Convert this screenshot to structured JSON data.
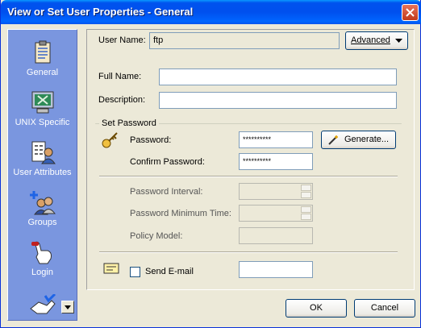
{
  "window": {
    "title": "View or Set User Properties - General"
  },
  "sidebar": {
    "items": [
      {
        "label": "General",
        "icon": "clipboard-icon"
      },
      {
        "label": "UNIX Specific",
        "icon": "unix-terminal-icon"
      },
      {
        "label": "User Attributes",
        "icon": "user-attributes-icon"
      },
      {
        "label": "Groups",
        "icon": "groups-icon"
      },
      {
        "label": "Login",
        "icon": "login-hand-icon"
      }
    ],
    "more_icon": "handshake-icon"
  },
  "header": {
    "user_name_label": "User Name:",
    "user_name_value": "ftp",
    "advanced_label": "Advanced"
  },
  "form": {
    "full_name_label": "Full Name:",
    "full_name_value": "",
    "description_label": "Description:",
    "description_value": ""
  },
  "set_password": {
    "group_title": "Set Password",
    "password_label": "Password:",
    "password_value": "**********",
    "confirm_label": "Confirm Password:",
    "confirm_value": "**********",
    "generate_label": "Generate...",
    "interval_label": "Password Interval:",
    "min_time_label": "Password Minimum Time:",
    "policy_label": "Policy Model:"
  },
  "email": {
    "send_label": "Send E-mail",
    "checked": false,
    "value": ""
  },
  "buttons": {
    "ok": "OK",
    "cancel": "Cancel"
  },
  "colors": {
    "titlebar": "#0053EE",
    "sidebar": "#7A96DF",
    "dialog": "#ECE9D8",
    "close": "#C1391B"
  }
}
